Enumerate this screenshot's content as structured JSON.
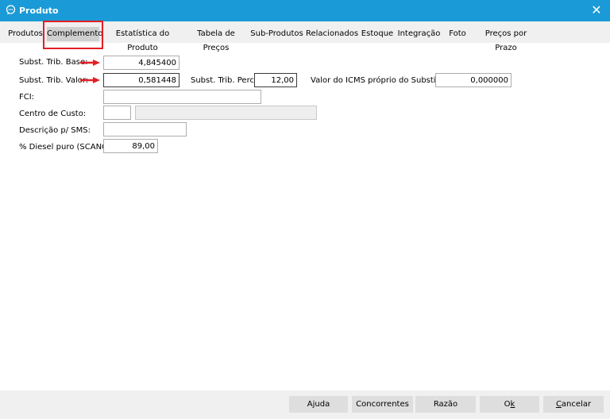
{
  "window": {
    "title": "Produto",
    "close_glyph": "✕"
  },
  "tabs": [
    {
      "label": "Produtos"
    },
    {
      "label": "Complemento",
      "active": true
    },
    {
      "label": "Estatística do Produto"
    },
    {
      "label": "Tabela de Preços"
    },
    {
      "label": "Sub-Produtos"
    },
    {
      "label": "Relacionados"
    },
    {
      "label": "Estoque"
    },
    {
      "label": "Integração"
    },
    {
      "label": "Foto"
    },
    {
      "label": "Preços por Prazo"
    }
  ],
  "form": {
    "subst_trib_base": {
      "label": "Subst. Trib. Base:",
      "value": "4,845400"
    },
    "subst_trib_valor": {
      "label": "Subst. Trib. Valor:",
      "value": "0,581448"
    },
    "subst_trib_perc": {
      "label": "Subst. Trib. Perc.:",
      "value": "12,00"
    },
    "valor_icms_proprio": {
      "label": "Valor do ICMS próprio do Substituto:",
      "value": "0,000000"
    },
    "fci": {
      "label": "FCI:",
      "value": ""
    },
    "centro_de_custo": {
      "label": "Centro de Custo:",
      "code": "",
      "description": ""
    },
    "descricao_sms": {
      "label": "Descrição p/ SMS:",
      "value": ""
    },
    "diesel_puro": {
      "label": "% Diesel puro (SCANC):",
      "value": "89,00"
    }
  },
  "buttons": {
    "ajuda": "Ajuda",
    "concorrentes": "Concorrentes",
    "razao": "Razão",
    "ok": {
      "pre": "O",
      "underline": "k",
      "post": ""
    },
    "cancelar": {
      "pre": "",
      "underline": "C",
      "post": "ancelar"
    }
  },
  "colors": {
    "titlebar": "#1a9ad6",
    "highlight_box": "#e31e24",
    "annotation_arrow": "#e31e24"
  },
  "icons": {
    "app": "chat-bubble-icon",
    "close": "close-icon",
    "annotation": "red-arrow-icon"
  }
}
